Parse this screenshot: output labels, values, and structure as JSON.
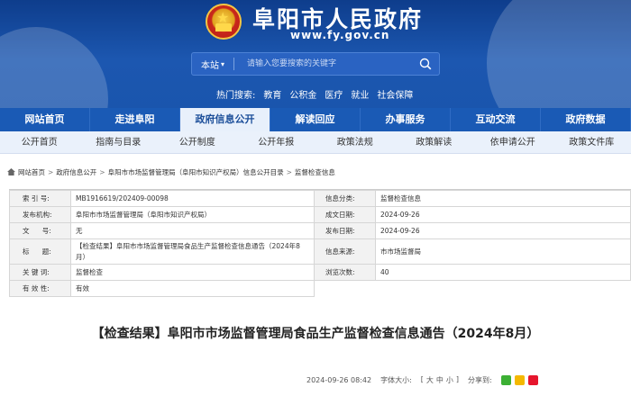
{
  "header": {
    "title": "阜阳市人民政府",
    "url": "www.fy.gov.cn"
  },
  "search": {
    "scope": "本站",
    "placeholder": "请输入您要搜索的关键字"
  },
  "hot": {
    "label": "热门搜索:",
    "items": [
      "教育",
      "公积金",
      "医疗",
      "就业",
      "社会保障"
    ]
  },
  "nav": {
    "items": [
      "网站首页",
      "走进阜阳",
      "政府信息公开",
      "解读回应",
      "办事服务",
      "互动交流",
      "政府数据"
    ],
    "active": "政府信息公开"
  },
  "subnav": {
    "items": [
      "公开首页",
      "指南与目录",
      "公开制度",
      "公开年报",
      "政策法规",
      "政策解读",
      "依申请公开",
      "政策文件库"
    ]
  },
  "breadcrumb": [
    "网站首页",
    "政府信息公开",
    "阜阳市市场监督管理局（阜阳市知识产权局）信息公开目录",
    "监督检查信息"
  ],
  "info": {
    "index_label": "索 引 号:",
    "index_value": "MB1916619/202409-00098",
    "category_label": "信息分类:",
    "category_value": "监督检查信息",
    "publisher_label": "发布机构:",
    "publisher_value": "阜阳市市场监督管理局（阜阳市知识产权局）",
    "created_label": "成文日期:",
    "created_value": "2024-09-26",
    "docno_label": "文      号:",
    "docno_value": "无",
    "pubdate_label": "发布日期:",
    "pubdate_value": "2024-09-26",
    "title_label": "标      题:",
    "title_value": "【检查结果】阜阳市市场监督管理局食品生产监督检查信息通告（2024年8月）",
    "source_label": "信息来源:",
    "source_value": "市市场监督局",
    "keyword_label": "关 键 词:",
    "keyword_value": "监督检查",
    "views_label": "浏览次数:",
    "views_value": "40",
    "validity_label": "有 效 性:",
    "validity_value": "有效"
  },
  "article": {
    "title": "【检查结果】阜阳市市场监督管理局食品生产监督检查信息通告（2024年8月）",
    "date": "2024-09-26 08:42",
    "font_label": "字体大小:",
    "font_sizes": [
      "大",
      "中",
      "小"
    ],
    "share_label": "分享到:"
  },
  "colors": {
    "nav_bg": "#1a5ab5",
    "banner": "#1c57b0",
    "active_tab_bg": "#e8f0fb"
  }
}
